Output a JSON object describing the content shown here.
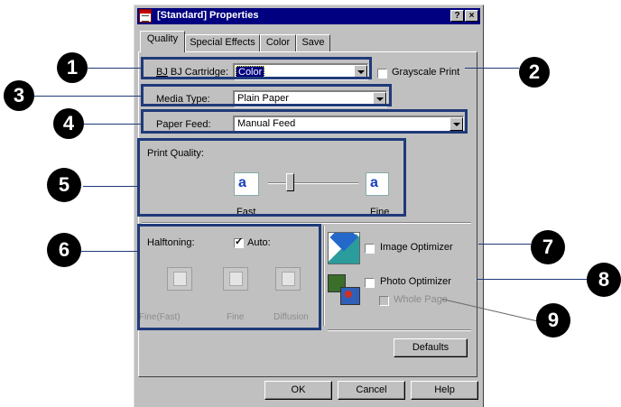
{
  "window": {
    "title": "[Standard] Properties",
    "help_btn": "?",
    "close_btn": "×"
  },
  "tabs": [
    "Quality",
    "Special Effects",
    "Color",
    "Save"
  ],
  "quality": {
    "cartridge_label": "BJ Cartridge:",
    "cartridge_value": "Color",
    "grayscale_label": "Grayscale Print",
    "media_label": "Media Type:",
    "media_value": "Plain Paper",
    "feed_label": "Paper Feed:",
    "feed_value": "Manual Feed",
    "print_quality_label": "Print Quality:",
    "slider_left_label": "Fast",
    "slider_right_label": "Fine",
    "slider_glyph": "a",
    "halftoning_label": "Halftoning:",
    "auto_label": "Auto:",
    "auto_checked": true,
    "halftone_options": [
      "Fine(Fast)",
      "Fine",
      "Diffusion"
    ],
    "image_optimizer_label": "Image Optimizer",
    "photo_optimizer_label": "Photo Optimizer",
    "whole_page_label": "Whole Page",
    "defaults_button": "Defaults"
  },
  "footer": {
    "ok": "OK",
    "cancel": "Cancel",
    "help": "Help"
  },
  "callouts": [
    "1",
    "2",
    "3",
    "4",
    "5",
    "6",
    "7",
    "8",
    "9"
  ],
  "colors": {
    "titlebar": "#000080",
    "callout_frame": "#1f3a7a",
    "dialog_face": "#c0c0c0"
  }
}
